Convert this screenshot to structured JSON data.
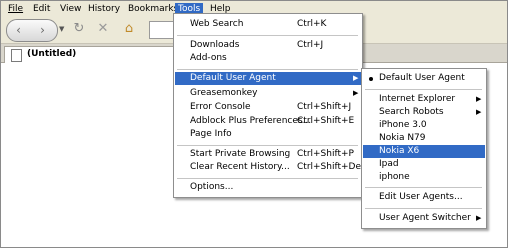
{
  "menubar": {
    "items": [
      {
        "label": "File"
      },
      {
        "label": "Edit"
      },
      {
        "label": "View"
      },
      {
        "label": "History"
      },
      {
        "label": "Bookmarks"
      },
      {
        "label": "Tools"
      },
      {
        "label": "Help"
      }
    ]
  },
  "tab": {
    "title": "(Untitled)"
  },
  "tools_menu": {
    "web_search": {
      "label": "Web Search",
      "shortcut": "Ctrl+K"
    },
    "downloads": {
      "label": "Downloads",
      "shortcut": "Ctrl+J"
    },
    "addons": {
      "label": "Add-ons"
    },
    "default_user_agent": {
      "label": "Default User Agent"
    },
    "greasemonkey": {
      "label": "Greasemonkey"
    },
    "error_console": {
      "label": "Error Console",
      "shortcut": "Ctrl+Shift+J"
    },
    "adblock": {
      "label": "Adblock Plus Preferences...",
      "shortcut": "Ctrl+Shift+E"
    },
    "page_info": {
      "label": "Page Info"
    },
    "private_browsing": {
      "label": "Start Private Browsing",
      "shortcut": "Ctrl+Shift+P"
    },
    "clear_history": {
      "label": "Clear Recent History...",
      "shortcut": "Ctrl+Shift+Del"
    },
    "options": {
      "label": "Options..."
    }
  },
  "ua_menu": {
    "default": {
      "label": "Default User Agent"
    },
    "ie": {
      "label": "Internet Explorer"
    },
    "robots": {
      "label": "Search Robots"
    },
    "iphone3": {
      "label": "iPhone 3.0"
    },
    "nokia_n79": {
      "label": "Nokia N79"
    },
    "nokia_x6": {
      "label": "Nokia X6"
    },
    "ipad": {
      "label": "Ipad"
    },
    "iphone": {
      "label": "iphone"
    },
    "edit": {
      "label": "Edit User Agents..."
    },
    "switcher": {
      "label": "User Agent Switcher"
    }
  },
  "colors": {
    "highlight": "#316ac5",
    "chrome": "#ece9d8"
  }
}
